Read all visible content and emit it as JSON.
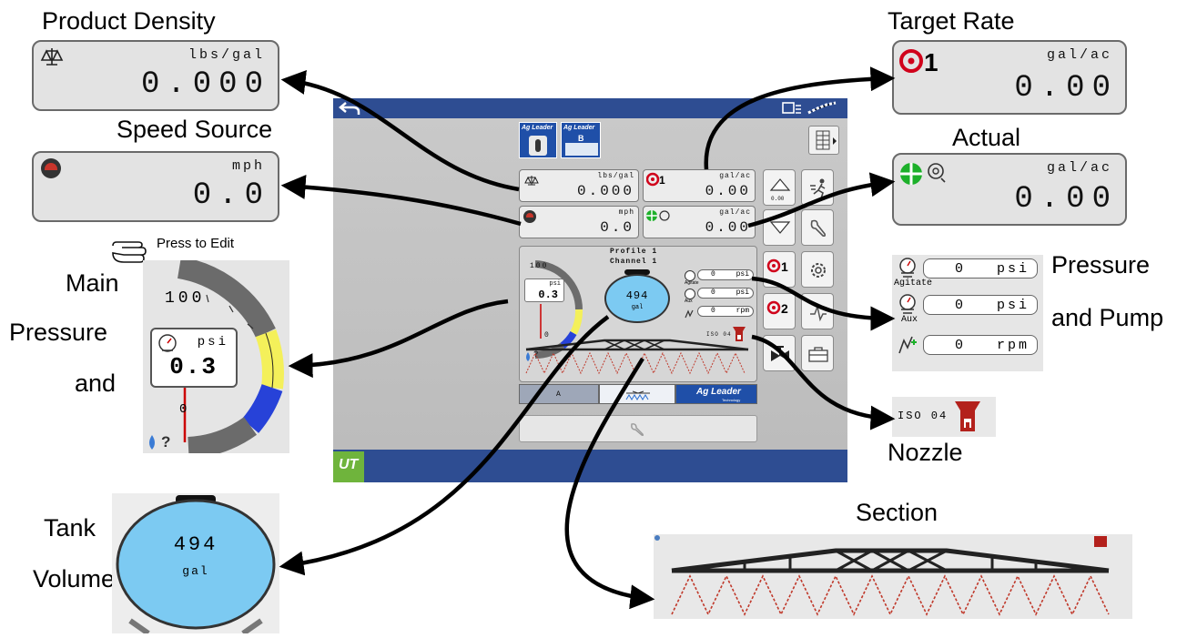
{
  "labels": {
    "product_density": "Product Density",
    "speed_source": "Speed Source",
    "target_rate": "Target Rate",
    "actual": "Actual",
    "press_to_edit": "Press to Edit",
    "main": "Main",
    "pressure": "Pressure",
    "and": "and",
    "pressure_pump_1": "Pressure",
    "pressure_pump_2": "and Pump",
    "nozzle": "Nozzle",
    "tank": "Tank",
    "volume": "Volume",
    "section": "Section"
  },
  "product_density": {
    "unit": "lbs/gal",
    "value": "0.000"
  },
  "speed_source": {
    "unit": "mph",
    "value": "0.0"
  },
  "target_rate": {
    "channel": "1",
    "unit": "gal/ac",
    "value": "0.00"
  },
  "actual": {
    "unit": "gal/ac",
    "value": "0.00"
  },
  "main_pressure": {
    "unit": "psi",
    "value": "0.3",
    "scale_high": "100",
    "scale_low": "0"
  },
  "pressure_pump": {
    "rows": [
      {
        "value": "0",
        "unit": "psi",
        "caption": "Agitate"
      },
      {
        "value": "0",
        "unit": "psi",
        "caption": "Aux"
      },
      {
        "value": "0",
        "unit": "rpm",
        "caption": ""
      }
    ]
  },
  "nozzle": {
    "code": "ISO 04"
  },
  "tank": {
    "volume": "494",
    "unit": "gal"
  },
  "device": {
    "profile": "Profile 1",
    "channel": "Channel 1",
    "density_unit": "lbs/gal",
    "density_value": "0.000",
    "target_unit": "gal/ac",
    "target_value": "0.00",
    "speed_unit": "mph",
    "speed_value": "0.0",
    "actual_unit": "gal/ac",
    "actual_value": "0.00",
    "gauge_value": "0.3",
    "gauge_unit": "psi",
    "gauge_high": "100",
    "gauge_low": "0",
    "agitate_value": "0",
    "agitate_unit": "psi",
    "agitate_caption": "Agitate",
    "aux_value": "0",
    "aux_unit": "psi",
    "aux_caption": "Aux",
    "pump_value": "0",
    "pump_unit": "rpm",
    "tank_value": "494",
    "tank_unit": "gal",
    "nozzle_code": "ISO 04",
    "tab1_logo": "Ag Leader",
    "tab2_logo": "Ag Leader",
    "tab2_letter": "B",
    "bottom_tab_a": "A",
    "bottom_logo": "Ag Leader",
    "bottom_logo_sub": "Technology",
    "ut_label": "UT",
    "rate_btn_1": "1",
    "rate_btn_2": "2",
    "step_label": "0.00"
  },
  "colors": {
    "frame_blue": "#2e4d92",
    "gauge_yellow": "#f4f05a",
    "gauge_blue": "#2742d8",
    "tank_blue": "#7ccaf2",
    "target_red": "#d0021b",
    "actual_green": "#1db02a",
    "nozzle_red": "#b3211c",
    "ut_green": "#6fb43c"
  },
  "icons": [
    "scale-icon",
    "speedometer-icon",
    "target-icon",
    "actual-rate-icon",
    "pressure-gauge-icon",
    "pump-icon",
    "nozzle-icon",
    "boom-icon",
    "back-arrow-icon",
    "gps-icon",
    "grid-menu-icon",
    "up-arrow-icon",
    "down-arrow-icon",
    "run-icon",
    "wrench-icon",
    "gear-icon",
    "valve-icon",
    "toolbox-icon",
    "hand-pointer-icon",
    "drop-icon",
    "help-icon"
  ]
}
